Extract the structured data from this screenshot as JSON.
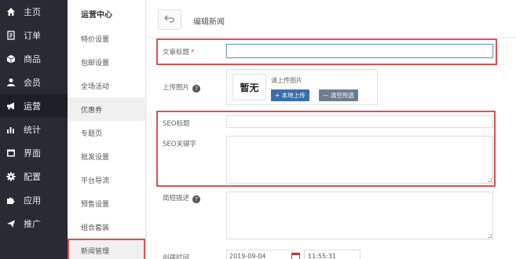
{
  "nav_primary": [
    {
      "label": "主页",
      "icon": "home-icon",
      "active": false
    },
    {
      "label": "订单",
      "icon": "order-icon",
      "active": false
    },
    {
      "label": "商品",
      "icon": "box-icon",
      "active": false
    },
    {
      "label": "会员",
      "icon": "user-icon",
      "active": false
    },
    {
      "label": "运营",
      "icon": "megaphone-icon",
      "active": true
    },
    {
      "label": "统计",
      "icon": "bar-chart-icon",
      "active": false
    },
    {
      "label": "界面",
      "icon": "layout-icon",
      "active": false
    },
    {
      "label": "配置",
      "icon": "gear-icon",
      "active": false
    },
    {
      "label": "应用",
      "icon": "puzzle-icon",
      "active": false
    },
    {
      "label": "推广",
      "icon": "send-icon",
      "active": false
    }
  ],
  "nav_secondary": {
    "heading": "运营中心",
    "items": [
      "特价设置",
      "包邮设置",
      "全场活动",
      "优惠券",
      "专题页",
      "批发设置",
      "平台导流",
      "预售设置",
      "组合套装",
      "新闻管理"
    ],
    "active_index": 3,
    "highlighted_index": 9
  },
  "header": {
    "title": "编辑新闻"
  },
  "form": {
    "article_title_label": "文章标题",
    "required_mark": "*",
    "article_title_value": "",
    "upload_label": "上传图片",
    "thumb_text": "暂无",
    "upload_hint": "请上传图片",
    "upload_local_button": "+ 本地上传",
    "clear_button": "— 清空所选",
    "seo_title_label": "SEO标题",
    "seo_title_value": "",
    "seo_keywords_label": "SEO关键字",
    "seo_keywords_value": "",
    "summary_label": "简短描述",
    "summary_value": "",
    "created_label": "创建时间",
    "created_date": "2019-09-04",
    "created_time": "11:55:31"
  },
  "colors": {
    "sidebar_bg": "#272b33",
    "accent": "#3a6ea8",
    "highlight": "#d9534f"
  }
}
